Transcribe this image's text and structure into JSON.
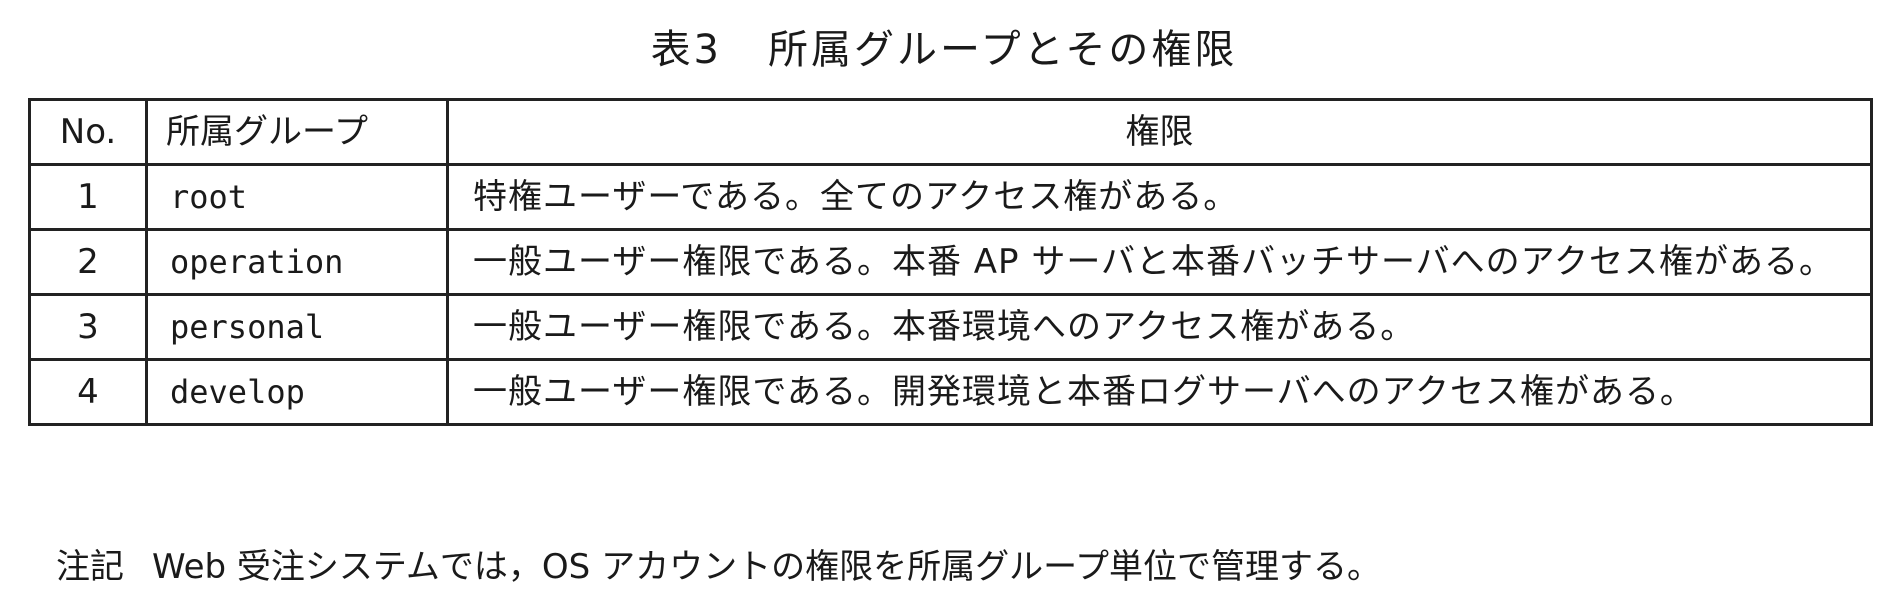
{
  "title": {
    "number": "表3",
    "text": "所属グループとその権限"
  },
  "table": {
    "headers": {
      "no": "No.",
      "group": "所属グループ",
      "permission": "権限"
    },
    "rows": [
      {
        "no": "1",
        "group": "root",
        "permission": "特権ユーザーである。全てのアクセス権がある。"
      },
      {
        "no": "2",
        "group": "operation",
        "permission": "一般ユーザー権限である。本番 AP サーバと本番バッチサーバへのアクセス権がある。"
      },
      {
        "no": "3",
        "group": "personal",
        "permission": "一般ユーザー権限である。本番環境へのアクセス権がある。"
      },
      {
        "no": "4",
        "group": "develop",
        "permission": "一般ユーザー権限である。開発環境と本番ログサーバへのアクセス権がある。"
      }
    ]
  },
  "note": {
    "label": "注記",
    "text": "Web 受注システムでは，OS アカウントの権限を所属グループ単位で管理する。"
  }
}
